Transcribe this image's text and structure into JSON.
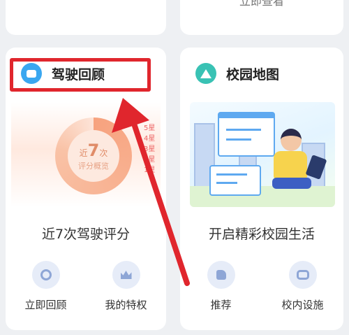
{
  "top_cards": {
    "left_link": "",
    "right_link": "立即查看"
  },
  "driving_review": {
    "title": "驾驶回顾",
    "ring_prefix": "近",
    "ring_count": "7",
    "ring_suffix": "次",
    "ring_sub": "评分概览",
    "legend": [
      "5星",
      "4星",
      "3星",
      "2星",
      "1星"
    ],
    "subtitle": "近7次驾驶评分",
    "actions": [
      {
        "label": "立即回顾",
        "icon": "review-icon"
      },
      {
        "label": "我的特权",
        "icon": "crown-icon"
      }
    ]
  },
  "campus_map": {
    "title": "校园地图",
    "subtitle": "开启精彩校园生活",
    "actions": [
      {
        "label": "推荐",
        "icon": "thumbs-up-icon"
      },
      {
        "label": "校内设施",
        "icon": "facility-icon"
      }
    ]
  },
  "annotation": {
    "highlight_color": "#e0262d",
    "arrow_color": "#e0262d"
  }
}
